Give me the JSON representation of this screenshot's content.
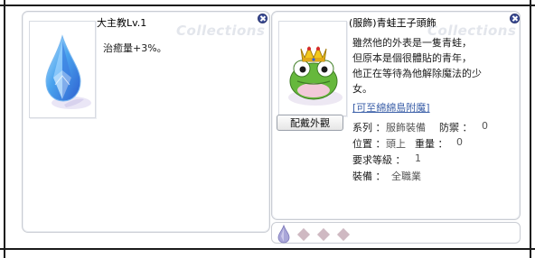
{
  "left_window": {
    "title": "大主教Lv.1",
    "watermark": "Collections",
    "description": "治癒量+3%。",
    "image": "blue-crystal-teardrop"
  },
  "right_window": {
    "title": "(服飾)青蛙王子頭飾",
    "watermark": "Collections",
    "image": "frog-prince-headgear",
    "description_lines": [
      "雖然他的外表是一隻青蛙，",
      "但原本是個很體貼的青年，",
      "他正在等待為他解除魔法的少",
      "女。"
    ],
    "link": "[可至綿綿島附魔]",
    "preview_button": "配戴外觀",
    "props": {
      "type_label": "系列 ：",
      "type_value": "服飾裝備",
      "defense_label": "防禦 ：",
      "defense_value": "0",
      "location_label": "位置 ：",
      "location_value": "頭上",
      "weight_label": "重量 ：",
      "weight_value": "0",
      "level_label": "要求等級 ：",
      "level_value": "1",
      "job_label": "裝備 ：",
      "job_value": "全職業"
    },
    "slots": [
      "slot-crystal",
      "slot-empty-1",
      "slot-empty-2",
      "slot-empty-3"
    ]
  },
  "colors": {
    "close_button": "#3a4c96",
    "link": "#3b5fa8",
    "watermark": "#e3e6ec"
  }
}
